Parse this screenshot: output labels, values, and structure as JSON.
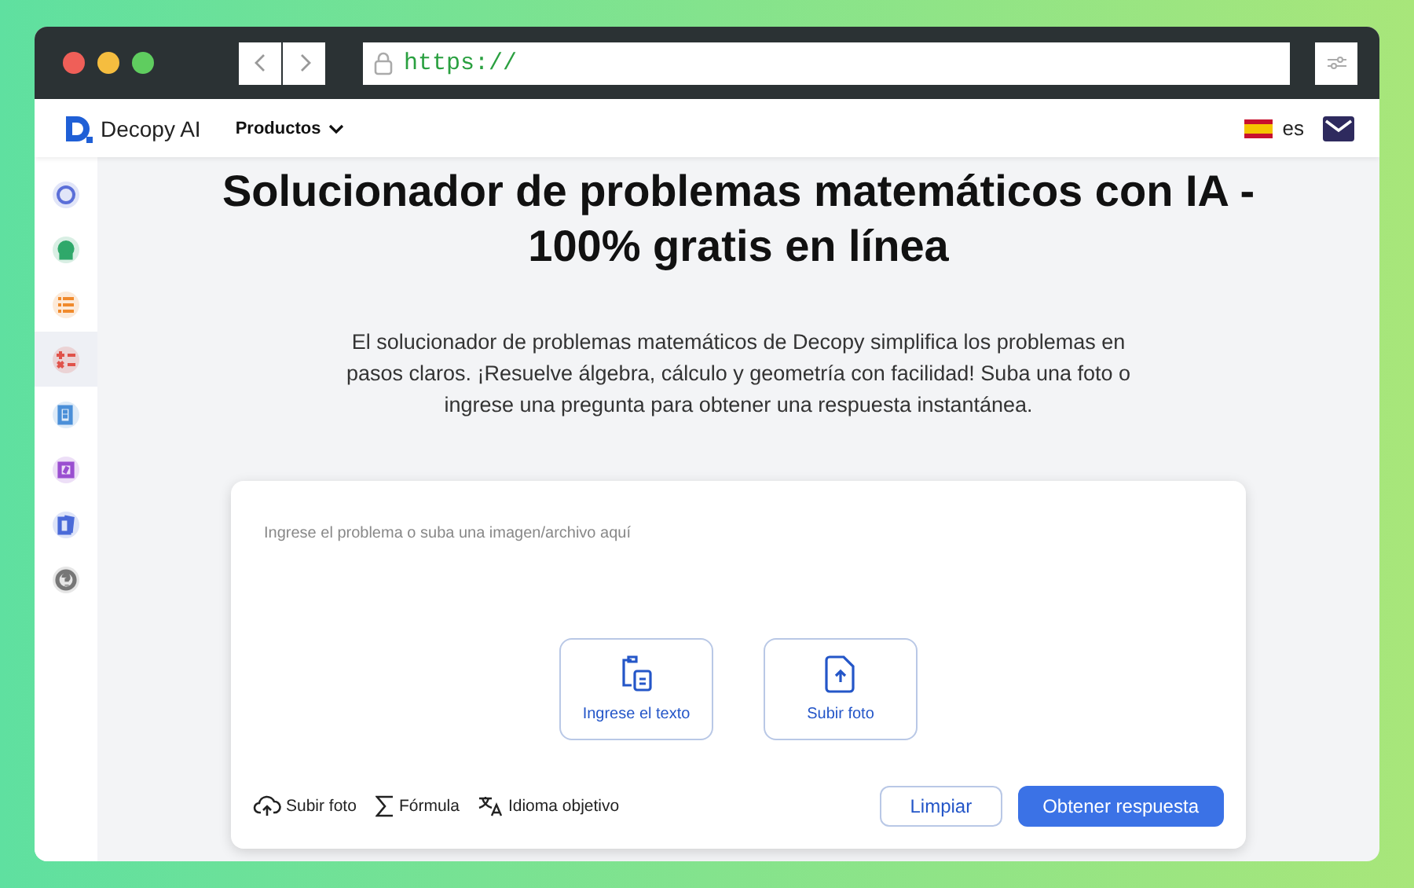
{
  "browser": {
    "url": "https://"
  },
  "nav": {
    "brand": "Decopy AI",
    "menu": "Productos",
    "language": "es"
  },
  "sidebar": {
    "items": [
      {
        "kind": "ai",
        "color": "#5b6fd8",
        "selected": false
      },
      {
        "kind": "head",
        "color": "#2fa86a",
        "selected": false
      },
      {
        "kind": "list",
        "color": "#f08a2c",
        "selected": false
      },
      {
        "kind": "math",
        "color": "#e0524a",
        "selected": true
      },
      {
        "kind": "note",
        "color": "#4a8fd8",
        "selected": false
      },
      {
        "kind": "formula",
        "color": "#9a4fd0",
        "selected": false
      },
      {
        "kind": "cards",
        "color": "#4a6ad8",
        "selected": false
      },
      {
        "kind": "help",
        "color": "#777777",
        "selected": false
      }
    ]
  },
  "heading": "Solucionador de problemas matemáticos con IA - 100% gratis en línea",
  "description": "El solucionador de problemas matemáticos de Decopy simplifica los problemas en pasos claros. ¡Resuelve álgebra, cálculo y geometría con facilidad! Suba una foto o ingrese una pregunta para obtener una respuesta instantánea.",
  "input": {
    "placeholder": "Ingrese el problema o suba una imagen/archivo aquí"
  },
  "tiles": [
    {
      "kind": "text",
      "label": "Ingrese el texto"
    },
    {
      "kind": "upload",
      "label": "Subir foto"
    }
  ],
  "tools": [
    {
      "kind": "upload",
      "label": "Subir foto"
    },
    {
      "kind": "formula",
      "label": "Fórmula"
    },
    {
      "kind": "translate",
      "label": "Idioma objetivo"
    }
  ],
  "buttons": [
    {
      "kind": "secondary",
      "label": "Limpiar"
    },
    {
      "kind": "primary",
      "label": "Obtener respuesta"
    }
  ]
}
